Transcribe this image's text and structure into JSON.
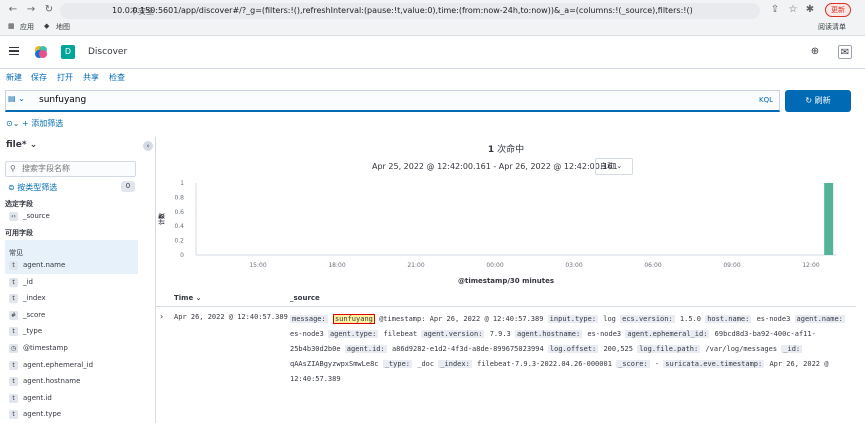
{
  "browser": {
    "insecure_label": "不安全",
    "url": "10.0.0.150:5601/app/discover#/?_g=(filters:!(),refreshInterval:(pause:!t,value:0),time:(from:now-24h,to:now))&_a=(columns:!(_source),filters:!(),index:b0bb9df0-c51a-1...",
    "update_label": "更新",
    "bookmarks": [
      "应用",
      "地图"
    ],
    "reading_list": "阅读清单"
  },
  "header": {
    "space_initial": "D",
    "title": "Discover"
  },
  "topnav": [
    "新建",
    "保存",
    "打开",
    "共享",
    "检查"
  ],
  "query": {
    "value": "sunfuyang",
    "language": "KQL",
    "refresh_label": "刷新",
    "add_filter": "+ 添加筛选"
  },
  "sidebar": {
    "index_pattern": "file*",
    "search_placeholder": "搜索字段名称",
    "type_filter_label": "按类型筛选",
    "type_filter_count": "0",
    "selected_title": "选定字段",
    "selected_fields": [
      {
        "type": "t",
        "name": "_source"
      }
    ],
    "available_title": "可用字段",
    "common_label": "常见",
    "available_fields": [
      {
        "type": "t",
        "name": "agent.name"
      },
      {
        "type": "t",
        "name": "_id"
      },
      {
        "type": "t",
        "name": "_index"
      },
      {
        "type": "#",
        "name": "_score"
      },
      {
        "type": "t",
        "name": "_type"
      },
      {
        "type": "◷",
        "name": "@timestamp"
      },
      {
        "type": "t",
        "name": "agent.ephemeral_id"
      },
      {
        "type": "t",
        "name": "agent.hostname"
      },
      {
        "type": "t",
        "name": "agent.id"
      },
      {
        "type": "t",
        "name": "agent.type"
      }
    ]
  },
  "main": {
    "hits_count": "1",
    "hits_label": "次命中",
    "time_range": "Apr 25, 2022 @ 12:42:00.161 - Apr 26, 2022 @ 12:42:00.161",
    "interval": "自动",
    "columns": [
      "Time",
      "_source"
    ]
  },
  "chart_data": {
    "type": "bar",
    "title": "",
    "xlabel": "@timestamp/30 minutes",
    "ylabel": "计数",
    "x_ticks": [
      "15:00",
      "18:00",
      "21:00",
      "00:00",
      "03:00",
      "06:00",
      "09:00",
      "12:00"
    ],
    "y_ticks": [
      "0",
      "0.2",
      "0.4",
      "0.6",
      "0.8",
      "1"
    ],
    "ylim": [
      0,
      1
    ],
    "bars": [
      {
        "x": "12:30",
        "value": 1
      }
    ],
    "color": "#54b399",
    "grid": false
  },
  "document": {
    "time": "Apr 26, 2022 @ 12:40:57.389",
    "fields": [
      {
        "k": "message:",
        "v": "@timestamp: Apr 26, 2022 @ 12:40:57.389",
        "hl": "sunfuyang"
      },
      {
        "k": "input.type:",
        "v": "log"
      },
      {
        "k": "ecs.version:",
        "v": "1.5.0"
      },
      {
        "k": "host.name:",
        "v": "es-node3"
      },
      {
        "k": "agent.name:",
        "v": "es-node3"
      },
      {
        "k": "agent.type:",
        "v": "filebeat"
      },
      {
        "k": "agent.version:",
        "v": "7.9.3"
      },
      {
        "k": "agent.hostname:",
        "v": "es-node3"
      },
      {
        "k": "agent.ephemeral_id:",
        "v": "69bcd8d3-ba92-400c-af11-25b4b30d2b0e"
      },
      {
        "k": "agent.id:",
        "v": "a86d9282-e1d2-4f3d-a8de-899675023994"
      },
      {
        "k": "log.offset:",
        "v": "200,525"
      },
      {
        "k": "log.file.path:",
        "v": "/var/log/messages"
      },
      {
        "k": "_id:",
        "v": "qAAsZIABgyzwpxSmwLe8c"
      },
      {
        "k": "_type:",
        "v": "_doc"
      },
      {
        "k": "_index:",
        "v": "filebeat-7.9.3-2022.04.26-000001"
      },
      {
        "k": "_score:",
        "v": "-"
      },
      {
        "k": "suricata.eve.timestamp:",
        "v": "Apr 26, 2022 @ 12:40:57.389"
      }
    ]
  }
}
